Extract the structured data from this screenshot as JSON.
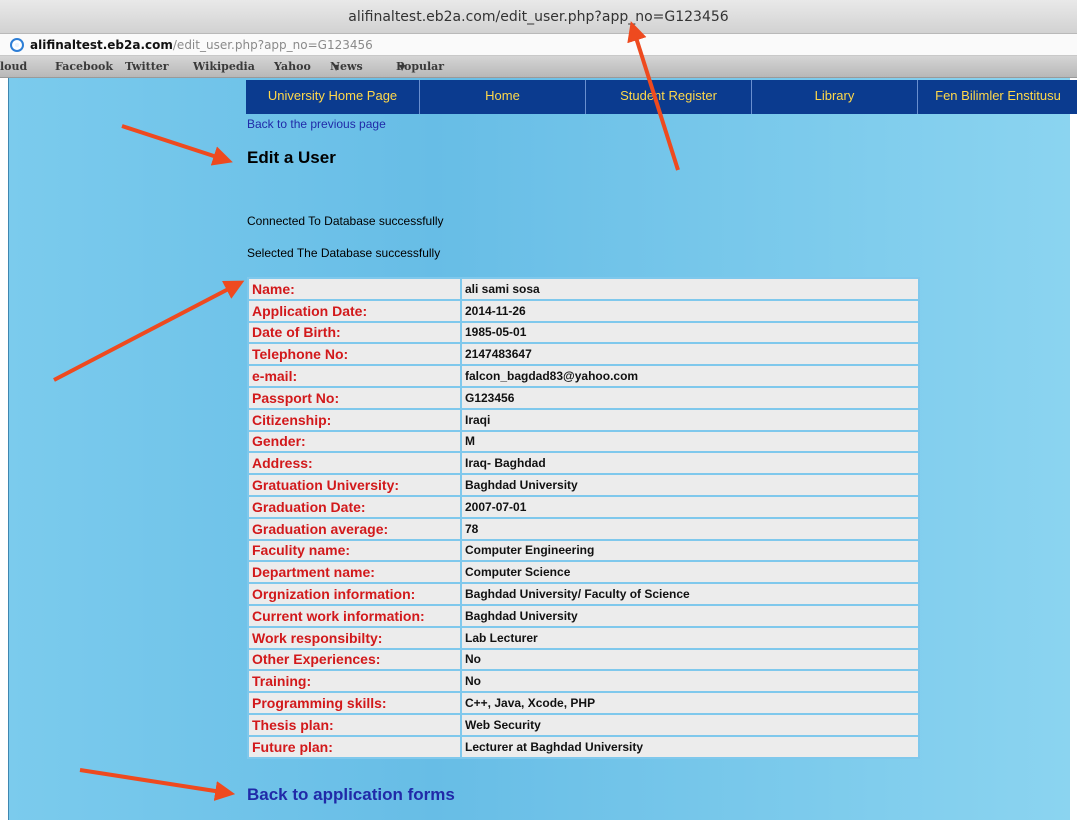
{
  "browser": {
    "title": "alifinaltest.eb2a.com/edit_user.php?app_no=G123456",
    "address_host": "alifinaltest.eb2a.com",
    "address_path": "/edit_user.php?app_no=G123456",
    "bookmarks": [
      "loud",
      "Facebook",
      "Twitter",
      "Wikipedia",
      "Yahoo",
      "News",
      "Popular"
    ],
    "globe_icon": "globe-icon",
    "dropdown_icon": "caret-down-icon"
  },
  "nav": {
    "items": [
      "University Home Page",
      "Home",
      "Student Register",
      "Library",
      "Fen Bilimler Enstitusu"
    ]
  },
  "page": {
    "back_link": "Back to the previous page",
    "title": "Edit a User",
    "status_connected": "Connected To Database successfully",
    "status_selected": "Selected The Database successfully",
    "footer_link": "Back to application forms"
  },
  "user": {
    "rows": [
      {
        "label": "Name:",
        "value": "ali sami sosa"
      },
      {
        "label": "Application Date:",
        "value": "2014-11-26"
      },
      {
        "label": "Date of Birth:",
        "value": "1985-05-01"
      },
      {
        "label": "Telephone No:",
        "value": "2147483647"
      },
      {
        "label": "e-mail:",
        "value": "falcon_bagdad83@yahoo.com"
      },
      {
        "label": "Passport No:",
        "value": "G123456"
      },
      {
        "label": "Citizenship:",
        "value": "Iraqi"
      },
      {
        "label": "Gender:",
        "value": "M"
      },
      {
        "label": "Address:",
        "value": "Iraq- Baghdad"
      },
      {
        "label": "Gratuation University:",
        "value": "Baghdad University"
      },
      {
        "label": "Graduation Date:",
        "value": "2007-07-01"
      },
      {
        "label": "Graduation average:",
        "value": "78"
      },
      {
        "label": "Faculity name:",
        "value": "Computer Engineering"
      },
      {
        "label": "Department name:",
        "value": "Computer Science"
      },
      {
        "label": "Orgnization information:",
        "value": "Baghdad University/ Faculty of Science"
      },
      {
        "label": "Current work information:",
        "value": "Baghdad University"
      },
      {
        "label": "Work responsibilty:",
        "value": "Lab Lecturer"
      },
      {
        "label": "Other Experiences:",
        "value": "No"
      },
      {
        "label": "Training:",
        "value": "No"
      },
      {
        "label": "Programming skills:",
        "value": "C++, Java, Xcode, PHP"
      },
      {
        "label": "Thesis plan:",
        "value": "Web Security"
      },
      {
        "label": "Future plan:",
        "value": "Lecturer at Baghdad University"
      }
    ]
  },
  "colors": {
    "nav_bg": "#0b3b8f",
    "nav_text": "#ffd84a",
    "label_red": "#d2191b",
    "link_blue": "#202aa8",
    "arrow": "#ee4a1f"
  }
}
